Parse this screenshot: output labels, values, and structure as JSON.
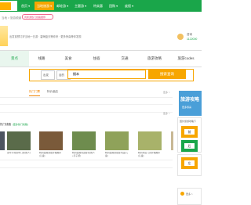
{
  "top_nav": {
    "items": [
      {
        "label": "首页 ▾",
        "active": false
      },
      {
        "label": "当地旅游 ▾",
        "active": true
      },
      {
        "label": "邮轮游 ▾",
        "active": false
      },
      {
        "label": "主题游 ▾",
        "active": false
      },
      {
        "label": "特卖惠",
        "active": false
      },
      {
        "label": "团购 ▾",
        "active": false
      },
      {
        "label": "度假 ▾",
        "active": false
      }
    ]
  },
  "subbar": {
    "breadcrumb": "当地 > 旅游频道",
    "badge": "周末游热门线路推荐"
  },
  "intro": {
    "text": "出发前预订好当地一日游 · 碧海蓝天等你来 · 更多惊喜等你发现",
    "right_label": "咨询",
    "right_value": "1122000"
  },
  "categories": [
    "景点",
    "线路",
    "美食",
    "住宿",
    "交通",
    "旅游攻略",
    "旅游codes"
  ],
  "search": {
    "select1": "出发",
    "select2": "目的",
    "placeholder": "",
    "value": "搜本",
    "button": "搜索查询"
  },
  "tabs": [
    {
      "label": "热门门票",
      "active": true
    },
    {
      "label": "特价酒店",
      "active": false
    }
  ],
  "more_label": "更多 >",
  "section_title": "热门线路",
  "section_sub": "[更多热门线路]",
  "thumbs": [
    {
      "color": "#4d5560",
      "caption": "世博园旅游路线推荐_乐游出游日游"
    },
    {
      "color": "#5a6b4a",
      "caption": "龙华平利游市门票(成人)"
    },
    {
      "color": "#7a5a3a",
      "caption": "杭州西湖游船价格推荐(儿童)"
    },
    {
      "color": "#6e8c4e",
      "caption": "杭州西湖周边游玩(成人+亲子游)"
    },
    {
      "color": "#8fa25a",
      "caption": "杭州西湖游船游乐园(儿童)"
    },
    {
      "color": "#a8b26a",
      "caption": "杭州景区门票价格推荐(儿童)"
    },
    {
      "color": "#c8b894",
      "caption": "杭州西湖景区门票_一级推荐"
    }
  ],
  "sidebar": {
    "ad_title": "旅游攻略",
    "ad_sub": "更多惊喜",
    "box1_title": "国外旅游攻略下",
    "box1_items": [
      "前",
      "后",
      "左"
    ],
    "box2_label": "更多 >"
  },
  "colors": {
    "brand_green": "#1aa64a",
    "accent_orange": "#f7a600"
  }
}
